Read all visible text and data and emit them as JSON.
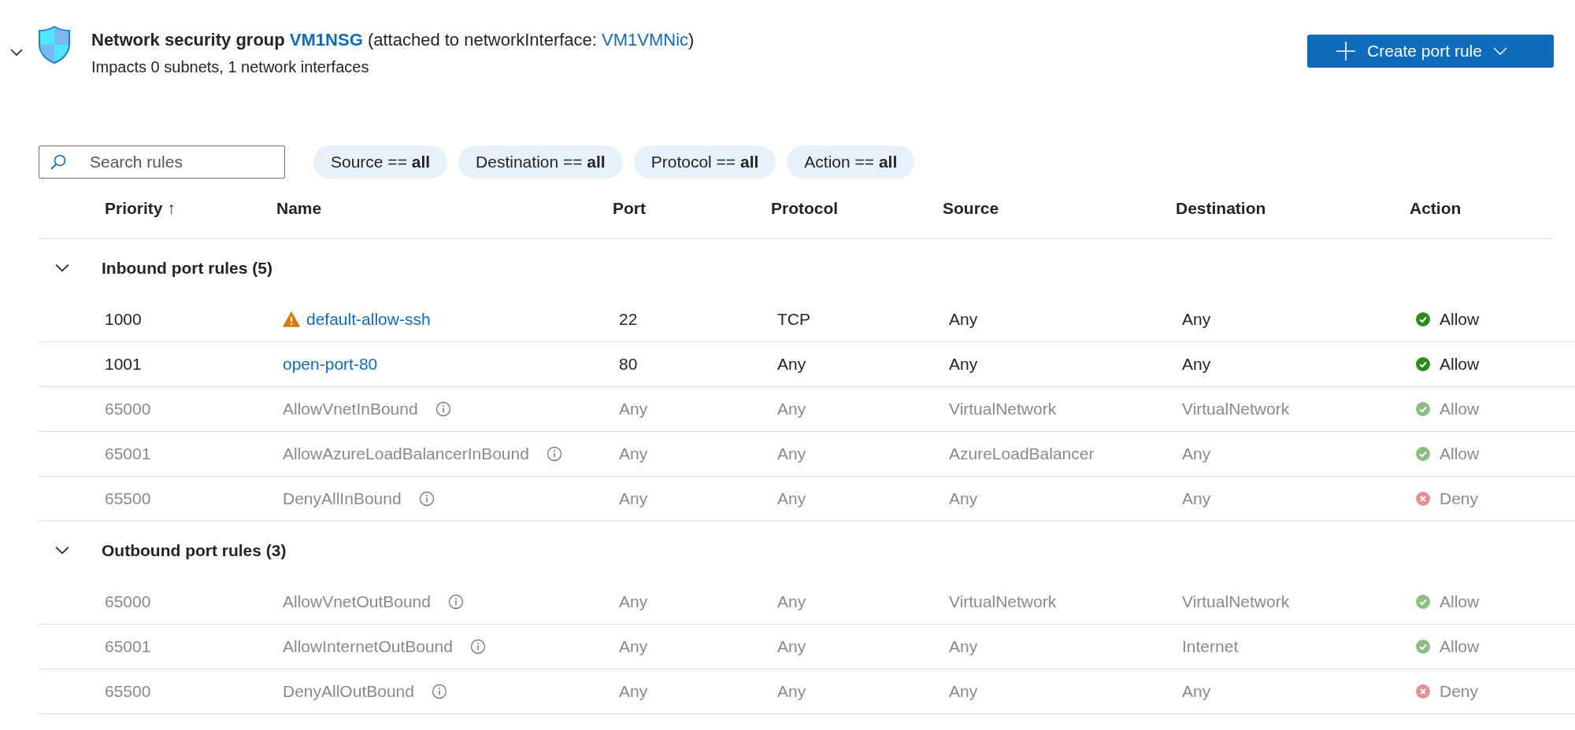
{
  "header": {
    "expanded": true,
    "title": "Network security group",
    "nsg_link": "VM1NSG",
    "attached_prefix": "(attached to networkInterface:",
    "nic_link": "VM1VMNic",
    "attached_suffix": ")",
    "subtitle": "Impacts 0 subnets, 1 network interfaces",
    "create_button": "Create port rule"
  },
  "search": {
    "placeholder": "Search rules"
  },
  "filters": [
    {
      "label": "Source == ",
      "value": "all"
    },
    {
      "label": "Destination == ",
      "value": "all"
    },
    {
      "label": "Protocol == ",
      "value": "all"
    },
    {
      "label": "Action == ",
      "value": "all"
    }
  ],
  "columns": [
    "Priority ↑",
    "Name",
    "Port",
    "Protocol",
    "Source",
    "Destination",
    "Action"
  ],
  "groups": [
    {
      "title": "Inbound port rules (5)",
      "expanded": true,
      "rows": [
        {
          "kind": "custom",
          "warning": true,
          "priority": "1000",
          "name": "default-allow-ssh",
          "port": "22",
          "protocol": "TCP",
          "source": "Any",
          "destination": "Any",
          "action": {
            "kind": "allow",
            "label": "Allow"
          }
        },
        {
          "kind": "custom",
          "warning": false,
          "priority": "1001",
          "name": "open-port-80",
          "port": "80",
          "protocol": "Any",
          "source": "Any",
          "destination": "Any",
          "action": {
            "kind": "allow",
            "label": "Allow"
          }
        },
        {
          "kind": "default",
          "warning": false,
          "priority": "65000",
          "name": "AllowVnetInBound",
          "port": "Any",
          "protocol": "Any",
          "source": "VirtualNetwork",
          "destination": "VirtualNetwork",
          "action": {
            "kind": "allow",
            "label": "Allow"
          }
        },
        {
          "kind": "default",
          "warning": false,
          "priority": "65001",
          "name": "AllowAzureLoadBalancerInBound",
          "port": "Any",
          "protocol": "Any",
          "source": "AzureLoadBalancer",
          "destination": "Any",
          "action": {
            "kind": "allow",
            "label": "Allow"
          }
        },
        {
          "kind": "default",
          "warning": false,
          "priority": "65500",
          "name": "DenyAllInBound",
          "port": "Any",
          "protocol": "Any",
          "source": "Any",
          "destination": "Any",
          "action": {
            "kind": "deny",
            "label": "Deny"
          }
        }
      ]
    },
    {
      "title": "Outbound port rules (3)",
      "expanded": true,
      "rows": [
        {
          "kind": "default",
          "warning": false,
          "priority": "65000",
          "name": "AllowVnetOutBound",
          "port": "Any",
          "protocol": "Any",
          "source": "VirtualNetwork",
          "destination": "VirtualNetwork",
          "action": {
            "kind": "allow",
            "label": "Allow"
          }
        },
        {
          "kind": "default",
          "warning": false,
          "priority": "65001",
          "name": "AllowInternetOutBound",
          "port": "Any",
          "protocol": "Any",
          "source": "Any",
          "destination": "Internet",
          "action": {
            "kind": "allow",
            "label": "Allow"
          }
        },
        {
          "kind": "default",
          "warning": false,
          "priority": "65500",
          "name": "DenyAllOutBound",
          "port": "Any",
          "protocol": "Any",
          "source": "Any",
          "destination": "Any",
          "action": {
            "kind": "deny",
            "label": "Deny"
          }
        }
      ]
    }
  ]
}
